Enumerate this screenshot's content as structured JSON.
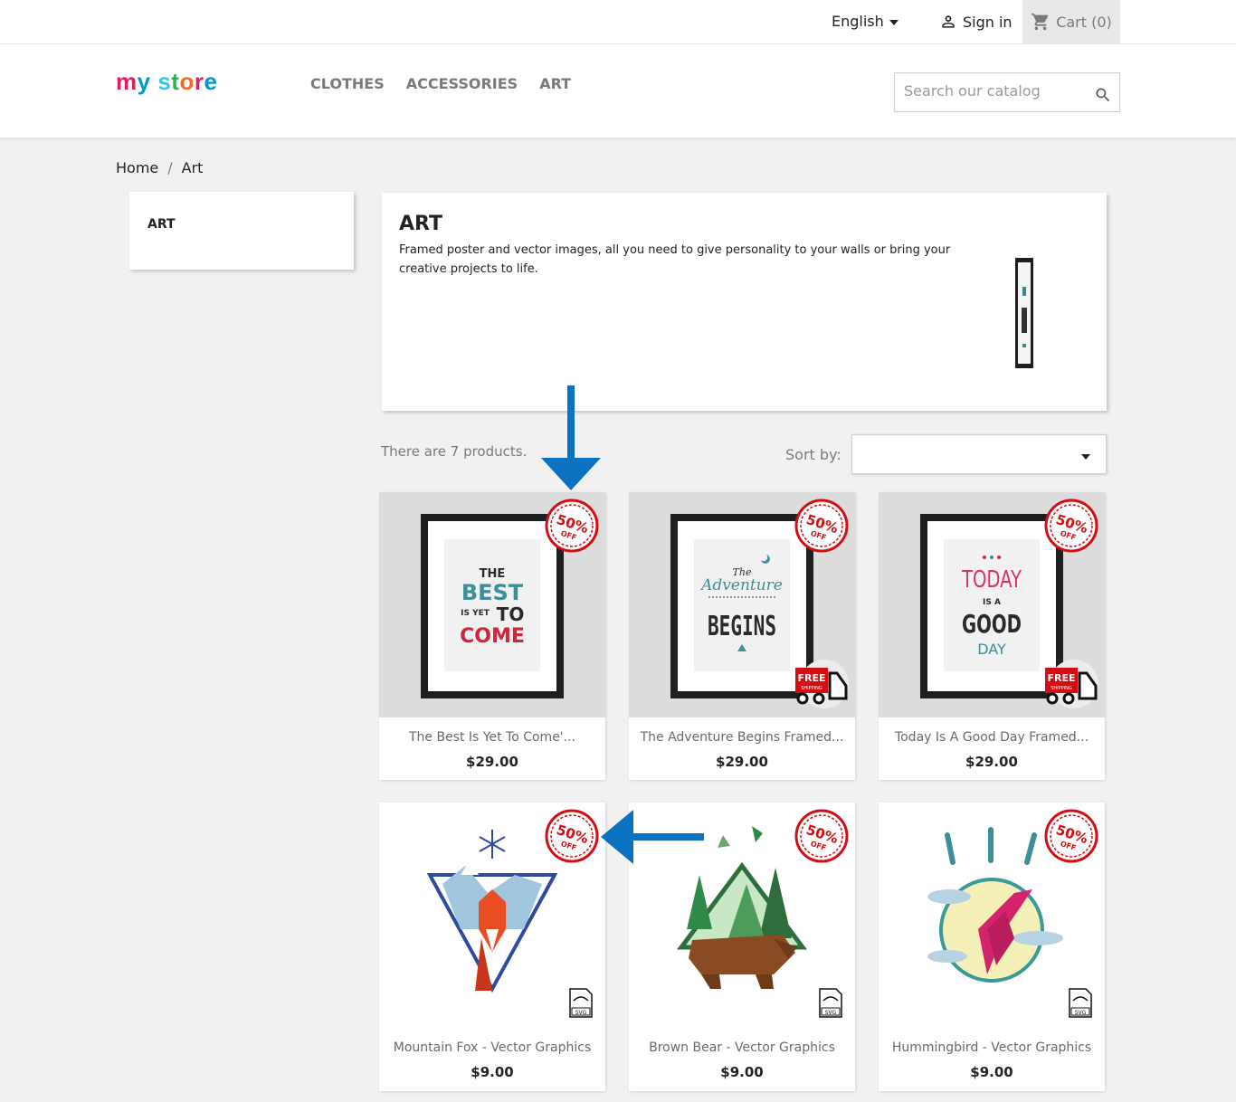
{
  "topbar": {
    "language": "English",
    "signin": "Sign in",
    "cart": "Cart (0)"
  },
  "header": {
    "logo_letters": [
      "m",
      "y",
      " ",
      "s",
      "t",
      "o",
      "r",
      "e"
    ],
    "logo_colors": [
      "#e11d5a",
      "#0099cc",
      "#ffffff",
      "#3ac3ea",
      "#2fb24c",
      "#f26b2a",
      "#e11d5a",
      "#0099cc"
    ],
    "nav": [
      "CLOTHES",
      "ACCESSORIES",
      "ART"
    ],
    "search_placeholder": "Search our catalog"
  },
  "breadcrumb": {
    "home": "Home",
    "sep": "/",
    "current": "Art"
  },
  "sidebar": {
    "title": "ART"
  },
  "category": {
    "title": "ART",
    "description": "Framed poster and vector images, all you need to give personality to your walls or bring your creative projects to life."
  },
  "listing": {
    "count": "There are 7 products.",
    "sort_label": "Sort by:",
    "sort_value": ""
  },
  "badges": {
    "discount": "50%",
    "off": "OFF",
    "free": "FREE",
    "shipping": "SHIPPING",
    "svg": "SVG"
  },
  "poster_text": {
    "p1": {
      "the": "THE",
      "best": "BEST",
      "is_yet": "IS YET",
      "to": "TO",
      "come": "COME"
    },
    "p2": {
      "the": "The",
      "adventure": "Adventure",
      "begins": "BEGINS"
    },
    "p3": {
      "today": "TODAY",
      "is_a": "IS A",
      "good": "GOOD",
      "day": "DAY"
    }
  },
  "products": [
    {
      "name": "The Best Is Yet To Come'...",
      "price": "$29.00"
    },
    {
      "name": "The Adventure Begins Framed...",
      "price": "$29.00"
    },
    {
      "name": "Today Is A Good Day Framed...",
      "price": "$29.00"
    },
    {
      "name": "Mountain Fox - Vector Graphics",
      "price": "$9.00"
    },
    {
      "name": "Brown Bear - Vector Graphics",
      "price": "$9.00"
    },
    {
      "name": "Hummingbird - Vector Graphics",
      "price": "$9.00"
    }
  ],
  "colors": {
    "badge_red": "#d40d12",
    "arrow_blue": "#0a72c0"
  }
}
